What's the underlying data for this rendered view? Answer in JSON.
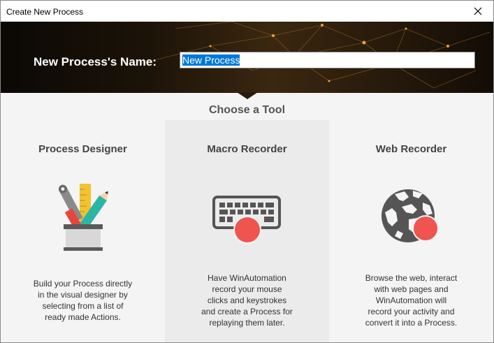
{
  "window": {
    "title": "Create New Process"
  },
  "header": {
    "name_label": "New Process's Name:",
    "name_value": "New Process"
  },
  "chooser": {
    "title": "Choose a Tool",
    "tools": [
      {
        "name": "Process Designer",
        "icon": "pencil-ruler-cup-icon",
        "description": "Build your Process directly\nin the visual designer by\nselecting from a list of\nready made Actions."
      },
      {
        "name": "Macro Recorder",
        "icon": "keyboard-record-icon",
        "description": "Have WinAutomation\nrecord your mouse\nclicks and keystrokes\nand create a Process for\nreplaying them later."
      },
      {
        "name": "Web Recorder",
        "icon": "globe-record-icon",
        "description": "Browse the web, interact\nwith web pages and\nWinAutomation will\nrecord your activity and\nconvert it into a Process."
      }
    ]
  },
  "colors": {
    "record_red": "#f0544f",
    "icon_gray": "#555555",
    "selection_blue": "#0078d7",
    "hover_panel": "#ebebeb"
  }
}
